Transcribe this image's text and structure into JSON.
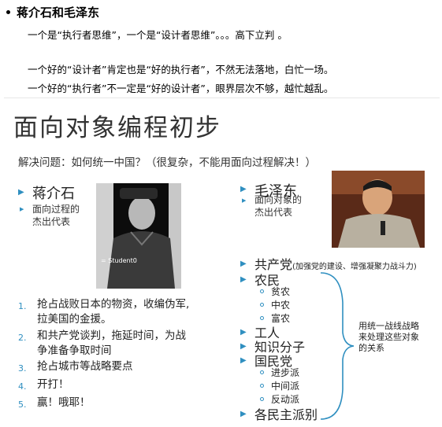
{
  "note": {
    "title": "蒋介石和毛泽东",
    "lines": [
      "一个是“执行者思维”，一个是“设计者思维”。。。高下立判 。",
      "一个好的“设计者”肯定也是“好的执行者”，不然无法落地，白忙一场。",
      "一个好的“执行者”不一定是“好的设计者”，眼界层次不够，越忙越乱。"
    ]
  },
  "slide": {
    "title": "面向对象编程初步",
    "subtitle": "解决问题：如何统一中国？（很复杂，不能用面向过程解决！）",
    "left": {
      "name": "蒋介石",
      "desc1": "面向过程的",
      "desc2": "杰出代表",
      "photo_label": "= Student0",
      "list": [
        {
          "num": "1.",
          "lines": [
            "抢占战败日本的物资，收编伪军,",
            "拉美国的金援。"
          ]
        },
        {
          "num": "2.",
          "lines": [
            "和共产党谈判，拖延时间，为战",
            "争准备争取时间"
          ]
        },
        {
          "num": "3.",
          "lines": [
            "抢占城市等战略要点"
          ]
        },
        {
          "num": "4.",
          "lines": [
            "开打！"
          ]
        },
        {
          "num": "5.",
          "lines": [
            "赢！哦耶！"
          ]
        }
      ]
    },
    "right": {
      "name": "毛泽东",
      "desc1": "面向对象的",
      "desc2": "杰出代表",
      "gcd": "共产党",
      "gcd_note": "(加强党的建设、增强凝聚力战斗力)",
      "nongmin": "农民",
      "nongmin_sub": [
        "贫农",
        "中农",
        "富农"
      ],
      "gongren": "工人",
      "zhishi": "知识分子",
      "guomindang": "国民党",
      "gmd_sub": [
        "进步派",
        "中间派",
        "反动派"
      ],
      "minzhu": "各民主派别",
      "brace_note": [
        "用统一战线战略",
        "来处理这些对象",
        "的关系"
      ]
    }
  }
}
